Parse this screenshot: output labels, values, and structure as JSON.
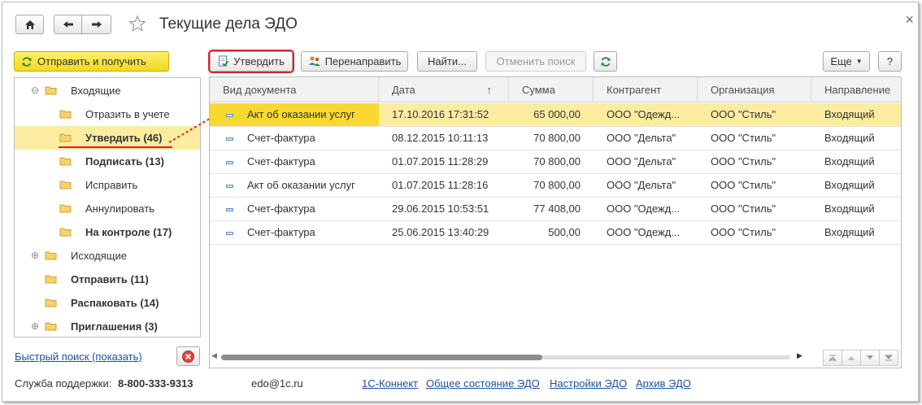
{
  "window": {
    "title": "Текущие дела ЭДО",
    "close_glyph": "×"
  },
  "left_panel": {
    "send_button": "Отправить и получить",
    "tree": [
      {
        "label": "Входящие",
        "bold": false,
        "level": 0,
        "expander": "⊖"
      },
      {
        "label": "Отразить в учете",
        "bold": false,
        "level": 1,
        "expander": ""
      },
      {
        "label": "Утвердить (46)",
        "bold": true,
        "level": 1,
        "expander": "",
        "selected": true
      },
      {
        "label": "Подписать (13)",
        "bold": true,
        "level": 1,
        "expander": ""
      },
      {
        "label": "Исправить",
        "bold": false,
        "level": 1,
        "expander": ""
      },
      {
        "label": "Аннулировать",
        "bold": false,
        "level": 1,
        "expander": ""
      },
      {
        "label": "На контроле (17)",
        "bold": true,
        "level": 1,
        "expander": ""
      },
      {
        "label": "Исходящие",
        "bold": false,
        "level": 0,
        "expander": "⊕"
      },
      {
        "label": "Отправить (11)",
        "bold": true,
        "level": 0,
        "expander": ""
      },
      {
        "label": "Распаковать (14)",
        "bold": true,
        "level": 0,
        "expander": ""
      },
      {
        "label": "Приглашения (3)",
        "bold": true,
        "level": 0,
        "expander": "⊕"
      }
    ],
    "quick_search_link": "Быстрый поиск (показать)"
  },
  "toolbar": {
    "approve": "Утвердить",
    "redirect": "Перенаправить",
    "find": "Найти...",
    "cancel_search": "Отменить поиск",
    "more": "Еще",
    "help": "?"
  },
  "grid": {
    "columns": [
      "Вид документа",
      "Дата",
      "Сумма",
      "Контрагент",
      "Организация",
      "Направление"
    ],
    "sort_indicator": "↑",
    "rows": [
      [
        "Акт об оказании услуг",
        "17.10.2016 17:31:52",
        "65 000,00",
        "ООО \"Одежд...",
        "ООО \"Стиль\"",
        "Входящий"
      ],
      [
        "Счет-фактура",
        "08.12.2015 10:11:13",
        "70 800,00",
        "ООО \"Дельта\"",
        "ООО \"Стиль\"",
        "Входящий"
      ],
      [
        "Счет-фактура",
        "01.07.2015 11:28:29",
        "70 800,00",
        "ООО \"Дельта\"",
        "ООО \"Стиль\"",
        "Входящий"
      ],
      [
        "Акт об оказании услуг",
        "01.07.2015 11:28:16",
        "70 800,00",
        "ООО \"Дельта\"",
        "ООО \"Стиль\"",
        "Входящий"
      ],
      [
        "Счет-фактура",
        "29.06.2015 10:53:51",
        "77 408,00",
        "ООО \"Одежд...",
        "ООО \"Стиль\"",
        "Входящий"
      ],
      [
        "Счет-фактура",
        "25.06.2015 13:40:29",
        "500,00",
        "ООО \"Одежд...",
        "ООО \"Стиль\"",
        "Входящий"
      ]
    ]
  },
  "footer": {
    "support_label": "Служба поддержки:",
    "support_phone": "8-800-333-9313",
    "email": "edo@1c.ru",
    "links": [
      "1С-Коннект",
      "Общее состояние ЭДО",
      "Настройки ЭДО",
      "Архив ЭДО"
    ]
  },
  "colors": {
    "accent_yellow": "#f2d91f",
    "selection": "#fbeca0",
    "highlight_red": "#d6262d",
    "link_blue": "#1e50a2"
  }
}
